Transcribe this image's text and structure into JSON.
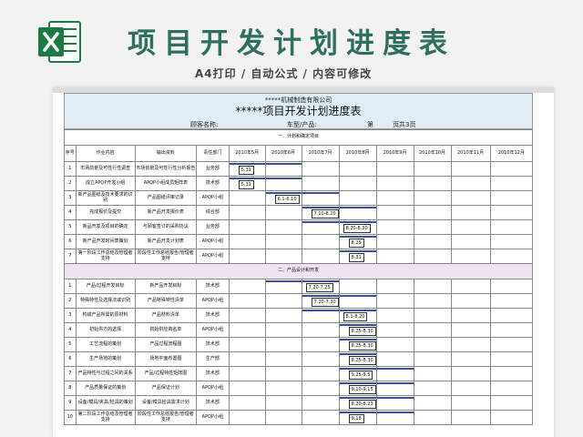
{
  "header": {
    "title": "项目开发计划进度表",
    "subtitle": "A4打印 / 自动公式 / 内容可修改"
  },
  "sheet": {
    "company": "*****机械制造有限公司",
    "title": "*****项目开发计划进度表",
    "customer_label": "顾客名称:",
    "model_label": "车型/产品:",
    "page_label": "第",
    "page_total_label": "页共3页"
  },
  "columns": [
    "序号",
    "作业内容",
    "输出资料",
    "责任部门",
    "2010年5月",
    "2010年6月",
    "2010年7月",
    "2010年8月",
    "2010年9月",
    "2010年10月",
    "2010年11月",
    "2010年12月"
  ],
  "sections": [
    {
      "title": "一、计划和确定项目",
      "rows": [
        {
          "no": "1",
          "task": "市场前景及可性行性调查",
          "output": "市场前景及可性行性分析报告",
          "dept": "业务部",
          "bar": [
            4,
            5
          ],
          "label": "5.31",
          "label_col": 4
        },
        {
          "no": "2",
          "task": "成立APQP开发小组",
          "output": "APQP小组成员矩阵表",
          "dept": "技术部",
          "bar": [
            4,
            5
          ],
          "label": "5.31",
          "label_col": 4
        },
        {
          "no": "3",
          "task": "新产品图纸及技术要求的识别",
          "output": "产品图纸评审记录",
          "dept": "APQP小组",
          "bar": [
            5,
            6
          ],
          "label": "6.1-6.10",
          "label_col": 5
        },
        {
          "no": "4",
          "task": "完成报价及提交",
          "output": "新产品开发报价表",
          "dept": "综合部",
          "bar": [
            6,
            7
          ],
          "label": "7.10-8.20",
          "label_col": 6
        },
        {
          "no": "5",
          "task": "新品开发及项目的确定",
          "output": "与顾客签订的采购协议",
          "dept": "业务部",
          "bar": [
            6,
            7
          ],
          "label": "8.20-8.30",
          "label_col": 7
        },
        {
          "no": "6",
          "task": "新产品开发时间表策划",
          "output": "新产品开发计划表",
          "dept": "APQP小组",
          "bar": [
            7,
            7
          ],
          "label": "8.25",
          "label_col": 7
        },
        {
          "no": "7",
          "task": "第一阶段工作总结及管理者支持",
          "output": "阶段性工作总结报告/管理者支持",
          "dept": "APQP小组",
          "bar": [
            7,
            7
          ],
          "label": "8.31",
          "label_col": 7
        }
      ]
    },
    {
      "title": "二、产品设计和开发",
      "rows": [
        {
          "no": "1",
          "task": "产品/过程开发目标",
          "output": "新产品开发目标",
          "dept": "技术部",
          "bar": [
            5,
            6
          ],
          "label": "7.20-7.25",
          "label_col": 6
        },
        {
          "no": "2",
          "task": "特殊特性及选择法或识别",
          "output": "产品特殊特性清单",
          "dept": "APQP小组",
          "bar": [
            6,
            7
          ],
          "label": "7.20-7.30",
          "label_col": 6
        },
        {
          "no": "3",
          "task": "构成产品所需的原材料",
          "output": "产品材料清单",
          "dept": "技术部",
          "bar": [
            6,
            7
          ],
          "label": "8.1-8.20",
          "label_col": 7
        },
        {
          "no": "4",
          "task": "初始供方的选择",
          "output": "初始供应商名单",
          "dept": "APQP小组",
          "bar": [
            7,
            7
          ],
          "label": "8.25-8.30",
          "label_col": 7
        },
        {
          "no": "5",
          "task": "工艺流程的策划",
          "output": "产品过程流程图",
          "dept": "技术部",
          "bar": [
            7,
            7
          ],
          "label": "8.25-8.30",
          "label_col": 7
        },
        {
          "no": "6",
          "task": "生产场地的策划",
          "output": "场地平面布置图",
          "dept": "生产部",
          "bar": [
            7,
            7
          ],
          "label": "8.25-8.30",
          "label_col": 7
        },
        {
          "no": "7",
          "task": "产品特性与过程之间的关系",
          "output": "产品/过程特性矩阵图",
          "dept": "技术部",
          "bar": [
            7,
            8
          ],
          "label": "9.25-9.5",
          "label_col": 7
        },
        {
          "no": "8",
          "task": "产品质量保证的策划",
          "output": "产品保证计划",
          "dept": "APQP小组",
          "bar": [
            7,
            8
          ],
          "label": "9.10-9.15",
          "label_col": 7
        },
        {
          "no": "9",
          "task": "设备/模具/夹具/检具的策划",
          "output": "设备/模具检具需求计划",
          "dept": "技术部",
          "bar": [
            7,
            8
          ],
          "label": "8.20-8.23",
          "label_col": 7
        },
        {
          "no": "10",
          "task": "第二阶段工作总结及管理者支持",
          "output": "阶段性工作总结报告/管理者支持",
          "dept": "APQP小组",
          "bar": [
            7,
            8
          ],
          "label": "9.18",
          "label_col": 7
        }
      ]
    }
  ],
  "colors": {
    "title": "#2e6f5e",
    "bar": "#3b4f9c",
    "section2_bg": "#f0e2f1",
    "titleblock_bg": "#dfeef5",
    "excel_green": "#1d7a45"
  }
}
